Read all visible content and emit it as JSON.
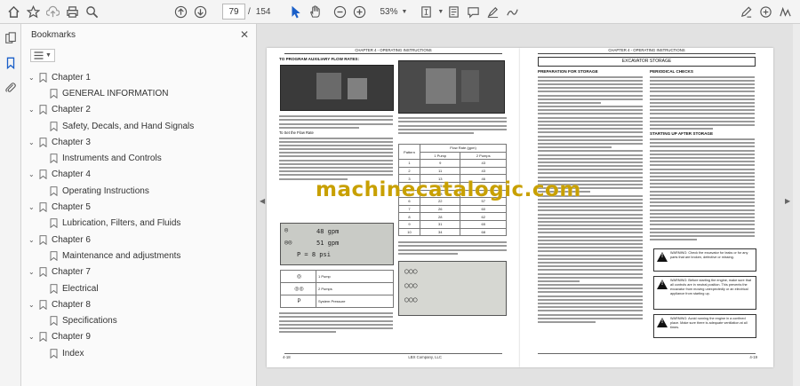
{
  "toolbar": {
    "current_page": "79",
    "page_separator": "/",
    "total_pages": "154",
    "zoom": "53%",
    "icons": [
      "home-icon",
      "star-icon",
      "upload-icon",
      "print-icon",
      "search-icon",
      "prev-page-icon",
      "next-page-icon",
      "cursor-icon",
      "hand-icon",
      "zoom-out-icon",
      "zoom-in-icon",
      "fit-page-icon",
      "page-view-icon",
      "comment-icon",
      "highlight-icon",
      "draw-icon",
      "fill-sign-icon",
      "share-icon",
      "sign-icon"
    ]
  },
  "panel": {
    "title": "Bookmarks",
    "close": "✕",
    "items": [
      {
        "level": 0,
        "label": "Chapter 1"
      },
      {
        "level": 1,
        "label": "GENERAL INFORMATION"
      },
      {
        "level": 0,
        "label": "Chapter 2"
      },
      {
        "level": 1,
        "label": "Safety, Decals, and Hand Signals"
      },
      {
        "level": 0,
        "label": "Chapter 3"
      },
      {
        "level": 1,
        "label": "Instruments and Controls"
      },
      {
        "level": 0,
        "label": "Chapter 4"
      },
      {
        "level": 1,
        "label": "Operating Instructions"
      },
      {
        "level": 0,
        "label": "Chapter 5"
      },
      {
        "level": 1,
        "label": "Lubrication, Filters, and Fluids"
      },
      {
        "level": 0,
        "label": "Chapter 6"
      },
      {
        "level": 1,
        "label": "Maintenance and adjustments"
      },
      {
        "level": 0,
        "label": "Chapter 7"
      },
      {
        "level": 1,
        "label": "Electrical"
      },
      {
        "level": 0,
        "label": "Chapter 8"
      },
      {
        "level": 1,
        "label": "Specifications"
      },
      {
        "level": 0,
        "label": "Chapter 9"
      },
      {
        "level": 1,
        "label": "Index"
      }
    ]
  },
  "document": {
    "left_header": "CHAPTER 4 - OPERATING INSTRUCTIONS",
    "right_header": "CHAPTER 4 - OPERATING INSTRUCTIONS",
    "left_footer_page": "4-18",
    "left_footer_company": "LBX Company, LLC",
    "right_footer_page": "4-19",
    "flow_section_title": "TO PROGRAM AUXILIARY FLOW RATES:",
    "set_flow_heading": "To Set the Flow Rate",
    "lcd_lines": [
      "48 gpm",
      "51 gpm",
      "P =  8 psi"
    ],
    "flow_table": {
      "col_pattern": "Pattern",
      "col_flow": "Flow Rate (gpm)",
      "col_1pump": "1 Pump",
      "col_2pumps": "2 Pumps",
      "rows": [
        [
          "1",
          "9",
          "43"
        ],
        [
          "2",
          "11",
          "43"
        ],
        [
          "3",
          "13",
          "46"
        ],
        [
          "4",
          "15",
          "49"
        ],
        [
          "5",
          "18",
          "52"
        ],
        [
          "6",
          "22",
          "57"
        ],
        [
          "7",
          "26",
          "60"
        ],
        [
          "8",
          "28",
          "62"
        ],
        [
          "9",
          "31",
          "65"
        ],
        [
          "10",
          "34",
          "68"
        ]
      ]
    },
    "icon_table": [
      {
        "symbol": "◎",
        "label": "1 Pump"
      },
      {
        "symbol": "◎◎",
        "label": "2 Pumps"
      },
      {
        "symbol": "P",
        "label": "System Pressure"
      }
    ],
    "excavator_storage_banner": "EXCAVATOR STORAGE",
    "prep_storage_title": "PREPARATION FOR STORAGE",
    "periodical_checks_title": "PERIODICAL CHECKS",
    "starting_after_title": "STARTING UP AFTER STORAGE",
    "warnings": [
      "WARNING: Check the excavator for leaks or for any parts that are broken, defective or missing.",
      "WARNING: Before starting the engine, make sure that all controls are in neutral position. This prevents the excavator from moving unexpectedly or an electrical appliance from starting up.",
      "WARNING: Avoid running the engine in a confined place. Make sure there is adequate ventilation at all times."
    ]
  },
  "watermark": "machinecatalogic.com"
}
